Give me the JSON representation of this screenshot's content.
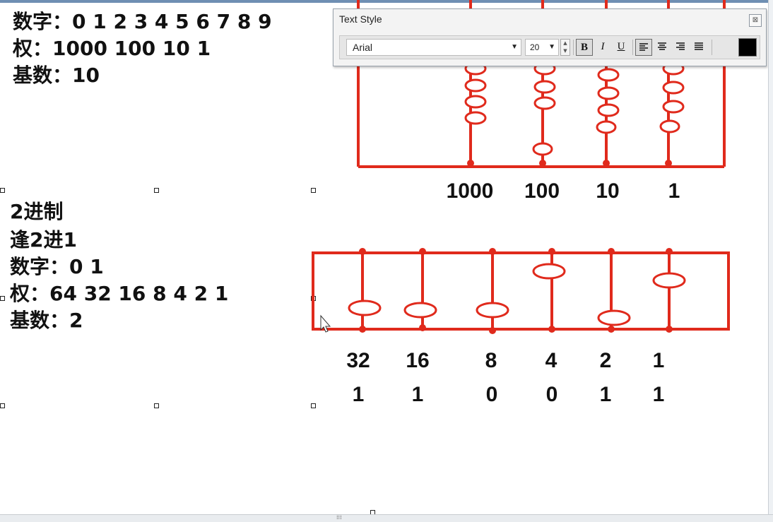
{
  "decimal": {
    "digits_line": "数字：0 1 2 3 4 5 6 7 8 9",
    "weights_line": "权：1000 100 10 1",
    "base_line": "基数：10",
    "place_labels": [
      "1000",
      "100",
      "10",
      "1"
    ]
  },
  "binary": {
    "title_line": "2进制",
    "rule_line": "逢2进1",
    "digits_line": "数字：0 1",
    "weights_line": "权：64 32 16 8 4 2 1",
    "base_line": "基数：2",
    "place_labels": [
      "32",
      "16",
      "8",
      "4",
      "2",
      "1"
    ],
    "bit_values": [
      "1",
      "1",
      "0",
      "0",
      "1",
      "1"
    ]
  },
  "text_style": {
    "title": "Text Style",
    "close_glyph": "⊠",
    "font_name": "Arial",
    "font_size": "20",
    "bold_label": "B",
    "italic_label": "I",
    "underline_label": "U",
    "color": "#000000"
  },
  "colors": {
    "abacus_red": "#e02a1c",
    "toolbar_bg": "#f3f3f3"
  }
}
